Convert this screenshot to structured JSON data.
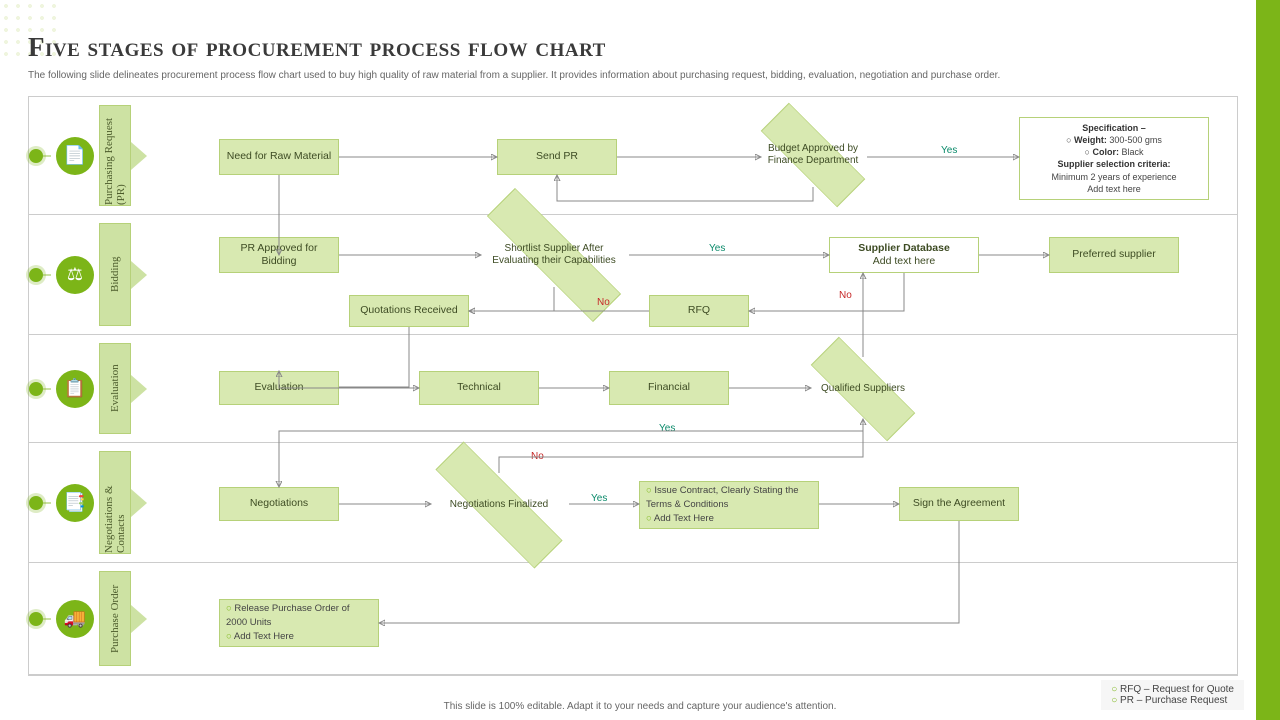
{
  "title": "Five stages of procurement process flow chart",
  "subtitle": "The following slide delineates procurement process flow chart used to buy high quality of raw material from a supplier. It provides information about purchasing request, bidding, evaluation, negotiation and purchase order.",
  "footer": "This slide is 100% editable. Adapt it to your needs and capture your audience's attention.",
  "legend": {
    "l1": "RFQ – Request for Quote",
    "l2": "PR – Purchase Request"
  },
  "lanes": {
    "pr": {
      "label": "Purchasing Request (PR)"
    },
    "bid": {
      "label": "Bidding"
    },
    "eval": {
      "label": "Evaluation"
    },
    "neg": {
      "label": "Negotiations & Contacts"
    },
    "po": {
      "label": "Purchase Order"
    }
  },
  "nodes": {
    "need": "Need for\nRaw Material",
    "sendpr": "Send PR",
    "budget": "Budget Approved by Finance Department",
    "spec_h1": "Specification –",
    "spec_w": "Weight: 300-500 gms",
    "spec_c": "Color: Black",
    "spec_h2": "Supplier selection criteria:",
    "spec_s1": "Minimum 2 years of experience",
    "spec_s2": "Add text here",
    "prapproved": "PR  Approved for Bidding",
    "shortlist": "Shortlist Supplier After Evaluating their Capabilities",
    "supdb_t": "Supplier Database",
    "supdb_s": "Add text here",
    "preferred": "Preferred supplier",
    "quotes": "Quotations Received",
    "rfq": "RFQ",
    "evaluation": "Evaluation",
    "technical": "Technical",
    "financial": "Financial",
    "qualified": "Qualified Suppliers",
    "negotiations": "Negotiations",
    "negfinal": "Negotiations Finalized",
    "issue1": "Issue Contract, Clearly Stating the Terms & Conditions",
    "issue2": "Add Text Here",
    "sign": "Sign the Agreement",
    "release1": "Release Purchase Order of 2000 Units",
    "release2": "Add Text Here"
  },
  "labels": {
    "yes": "Yes",
    "no": "No"
  }
}
